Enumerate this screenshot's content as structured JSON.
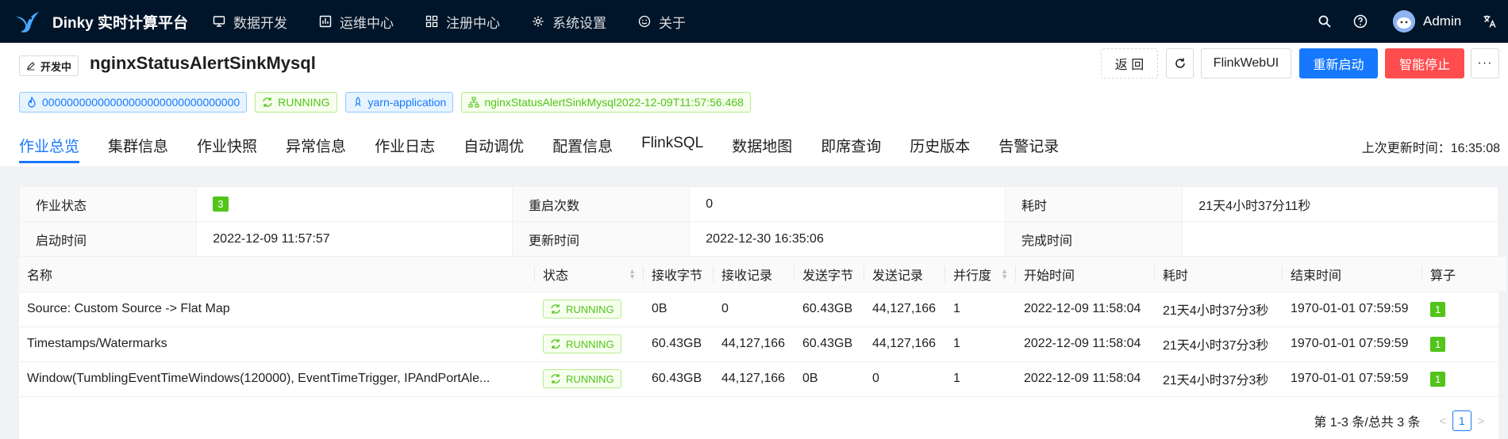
{
  "topbar": {
    "app_name": "Dinky 实时计算平台",
    "nav": [
      {
        "label": "数据开发",
        "icon": "monitor-icon"
      },
      {
        "label": "运维中心",
        "icon": "dashboard-icon"
      },
      {
        "label": "注册中心",
        "icon": "appstore-icon"
      },
      {
        "label": "系统设置",
        "icon": "setting-icon"
      },
      {
        "label": "关于",
        "icon": "smile-icon"
      }
    ],
    "user": "Admin"
  },
  "job": {
    "status_tag": "开发中",
    "name": "nginxStatusAlertSinkMysql",
    "tags": {
      "job_id": "00000000000000000000000000000000",
      "state": "RUNNING",
      "mode": "yarn-application",
      "instance": "nginxStatusAlertSinkMysql2022-12-09T11:57:56.468"
    }
  },
  "actions": {
    "back": "返 回",
    "flink_web_ui": "FlinkWebUI",
    "restart": "重新启动",
    "stop": "智能停止",
    "more": "···"
  },
  "tabs": [
    "作业总览",
    "集群信息",
    "作业快照",
    "异常信息",
    "作业日志",
    "自动调优",
    "配置信息",
    "FlinkSQL",
    "数据地图",
    "即席查询",
    "历史版本",
    "告警记录"
  ],
  "last_update": "上次更新时间：16:35:08",
  "overview": {
    "labels": {
      "job_status": "作业状态",
      "restart_count": "重启次数",
      "duration": "耗时",
      "start_time": "启动时间",
      "update_time": "更新时间",
      "finish_time": "完成时间"
    },
    "values": {
      "job_status": "3",
      "restart_count": "0",
      "duration": "21天4小时37分11秒",
      "start_time": "2022-12-09 11:57:57",
      "update_time": "2022-12-30 16:35:06",
      "finish_time": ""
    }
  },
  "vertices": {
    "columns": [
      "名称",
      "状态",
      "接收字节",
      "接收记录",
      "发送字节",
      "发送记录",
      "并行度",
      "开始时间",
      "耗时",
      "结束时间",
      "算子"
    ],
    "rows": [
      {
        "name": "Source: Custom Source -> Flat Map",
        "status": "RUNNING",
        "recv_bytes": "0B",
        "recv_records": "0",
        "send_bytes": "60.43GB",
        "send_records": "44,127,166",
        "parallelism": "1",
        "start": "2022-12-09 11:58:04",
        "duration": "21天4小时37分3秒",
        "end": "1970-01-01 07:59:59",
        "tasks": "1"
      },
      {
        "name": "Timestamps/Watermarks",
        "status": "RUNNING",
        "recv_bytes": "60.43GB",
        "recv_records": "44,127,166",
        "send_bytes": "60.43GB",
        "send_records": "44,127,166",
        "parallelism": "1",
        "start": "2022-12-09 11:58:04",
        "duration": "21天4小时37分3秒",
        "end": "1970-01-01 07:59:59",
        "tasks": "1"
      },
      {
        "name": "Window(TumblingEventTimeWindows(120000), EventTimeTrigger, IPAndPortAle...",
        "status": "RUNNING",
        "recv_bytes": "60.43GB",
        "recv_records": "44,127,166",
        "send_bytes": "0B",
        "send_records": "0",
        "parallelism": "1",
        "start": "2022-12-09 11:58:04",
        "duration": "21天4小时37分3秒",
        "end": "1970-01-01 07:59:59",
        "tasks": "1"
      }
    ]
  },
  "pagination": {
    "total": "第 1-3 条/总共 3 条",
    "current": "1"
  }
}
